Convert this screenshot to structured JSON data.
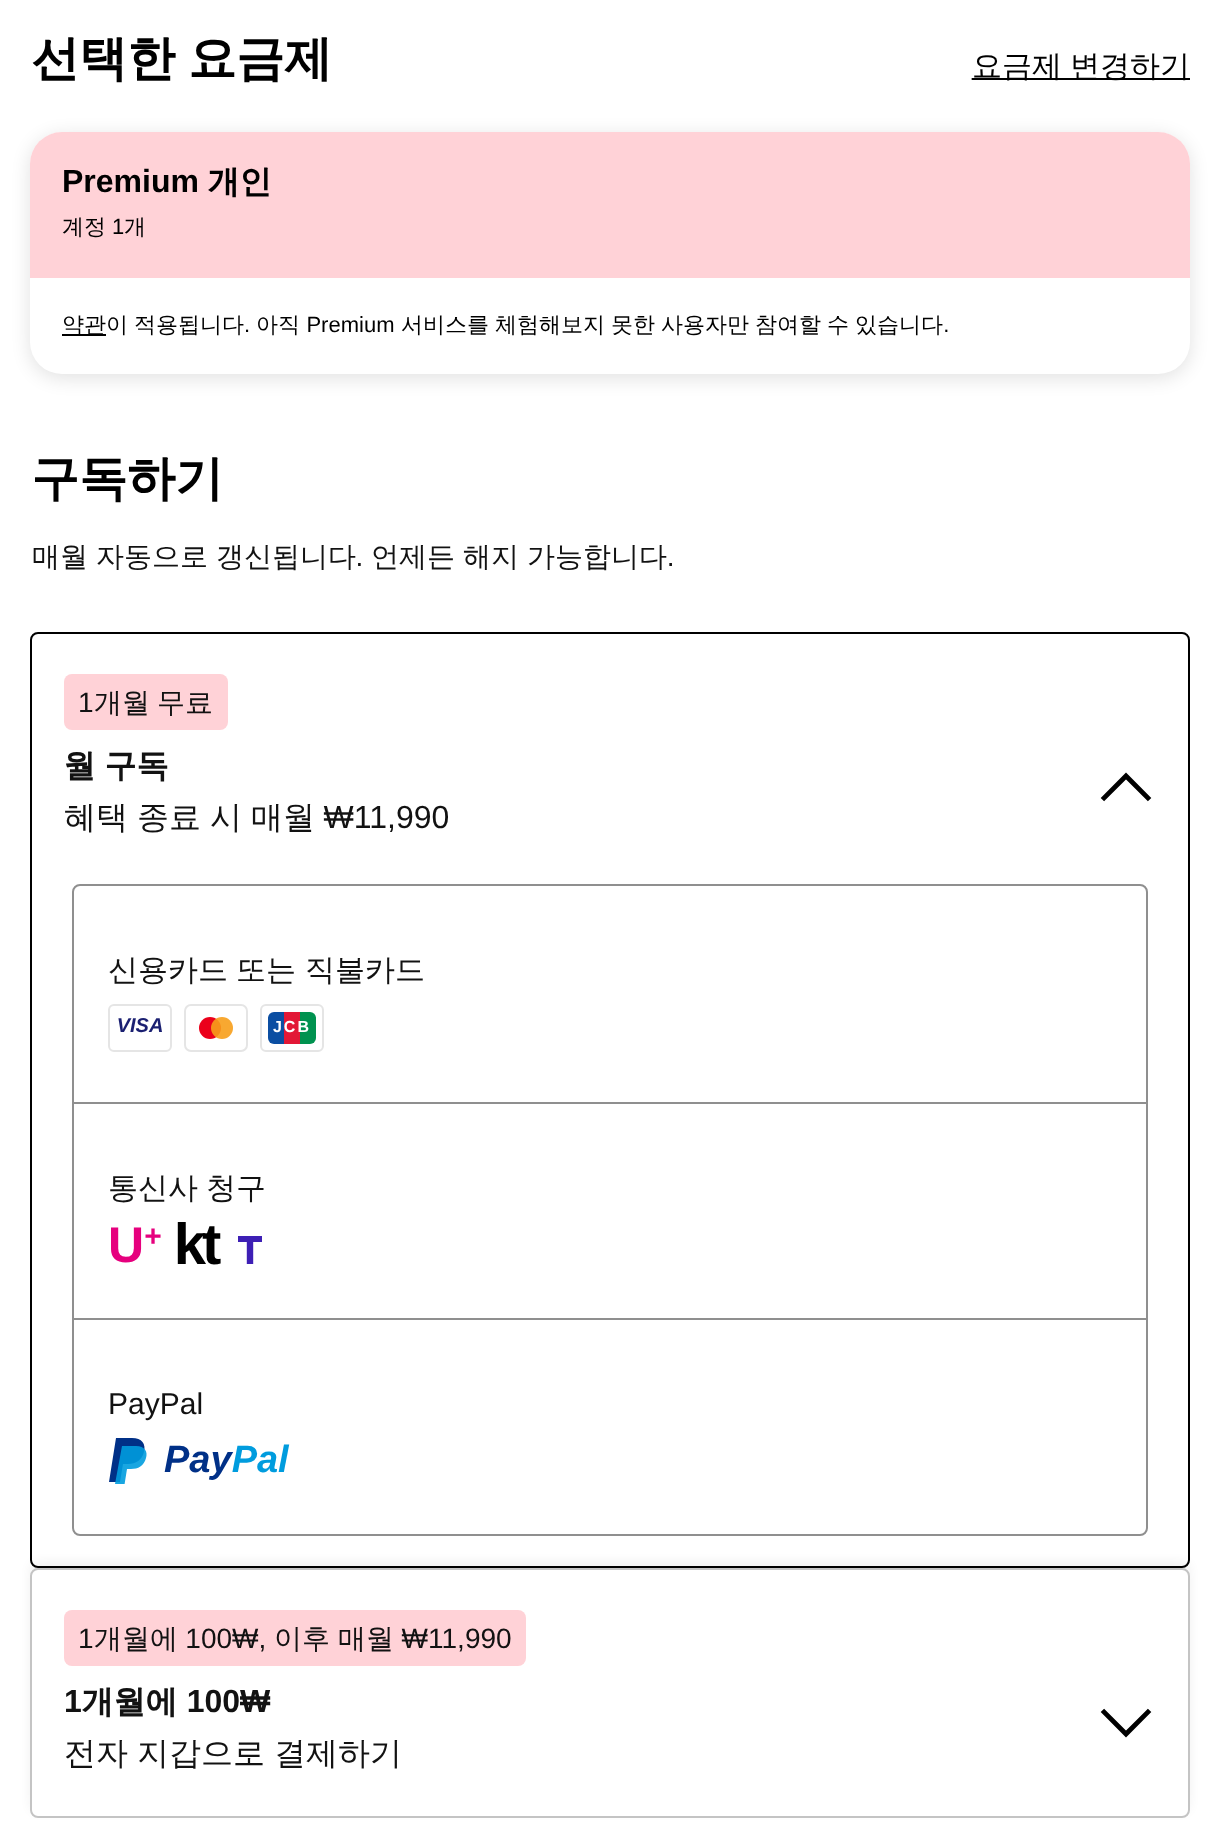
{
  "header": {
    "title": "선택한 요금제",
    "change_plan_link": "요금제 변경하기"
  },
  "selected_plan": {
    "name": "Premium 개인",
    "accounts": "계정 1개",
    "terms_link": "약관",
    "terms_text": "이 적용됩니다. 아직 Premium 서비스를 체험해보지 못한 사용자만 참여할 수 있습니다."
  },
  "subscribe": {
    "title": "구독하기",
    "note": "매월 자동으로 갱신됩니다. 언제든 해지 가능합니다."
  },
  "offers": [
    {
      "badge": "1개월 무료",
      "title": "월 구독",
      "subtitle": "혜택 종료 시 매월 ₩11,990",
      "expanded": true,
      "payment_methods": [
        {
          "label": "신용카드 또는 직불카드",
          "logos": [
            {
              "kind": "visa",
              "text": "VISA"
            },
            {
              "kind": "mastercard"
            },
            {
              "kind": "jcb",
              "text": "JCB"
            }
          ]
        },
        {
          "label": "통신사 청구",
          "logos": [
            {
              "kind": "lguplus",
              "text": "U$^{+}$"
            },
            {
              "kind": "kt",
              "text": "kt"
            },
            {
              "kind": "skt"
            }
          ]
        },
        {
          "label": "PayPal",
          "logos": [
            {
              "kind": "paypal_mark"
            },
            {
              "kind": "paypal_wordmark",
              "parts": [
                "Pay",
                "Pal"
              ]
            }
          ]
        }
      ]
    },
    {
      "badge": "1개월에 100₩, 이후 매월 ₩11,990",
      "title": "1개월에 100₩",
      "subtitle": "전자 지갑으로 결제하기",
      "expanded": false
    }
  ]
}
